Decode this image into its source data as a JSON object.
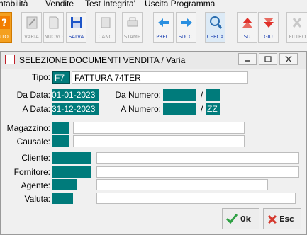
{
  "menu": [
    "ntabilità",
    "Vendite",
    "Test Integrita'",
    "Uscita Programma"
  ],
  "toolbar": {
    "buttons": [
      {
        "label": "UTO"
      },
      {
        "label": "VARIA"
      },
      {
        "label": "NUOVO"
      },
      {
        "label": "SALVA"
      },
      {
        "label": "CANC"
      },
      {
        "label": "STAMP"
      },
      {
        "label": "PREC."
      },
      {
        "label": "SUCC."
      },
      {
        "label": "CERCA"
      },
      {
        "label": "SU"
      },
      {
        "label": "GIU"
      },
      {
        "label": "FILTRO"
      }
    ]
  },
  "dialog": {
    "title": "SELEZIONE DOCUMENTI VENDITA / Varia",
    "tipo": {
      "label": "Tipo:",
      "code": "F7",
      "desc": "FATTURA 74TER"
    },
    "da_data": {
      "label": "Da Data:",
      "value": "01-01-2023"
    },
    "a_data": {
      "label": "A  Data:",
      "value": "31-12-2023"
    },
    "da_numero": {
      "label": "Da Numero:",
      "value": "",
      "sep": "/",
      "suffix": ""
    },
    "a_numero": {
      "label": "A  Numero:",
      "value": "",
      "sep": "/",
      "suffix": "ZZ"
    },
    "magazzino": {
      "label": "Magazzino:",
      "code": "",
      "desc": ""
    },
    "causale": {
      "label": "Causale:",
      "code": "",
      "desc": ""
    },
    "cliente": {
      "label": "Cliente:",
      "code": "",
      "desc": ""
    },
    "fornitore": {
      "label": "Fornitore:",
      "code": "",
      "desc": ""
    },
    "agente": {
      "label": "Agente:",
      "code": "",
      "desc": ""
    },
    "valuta": {
      "label": "Valuta:",
      "code": "",
      "desc": ""
    },
    "ok_label": "0k",
    "esc_label": "Esc"
  }
}
